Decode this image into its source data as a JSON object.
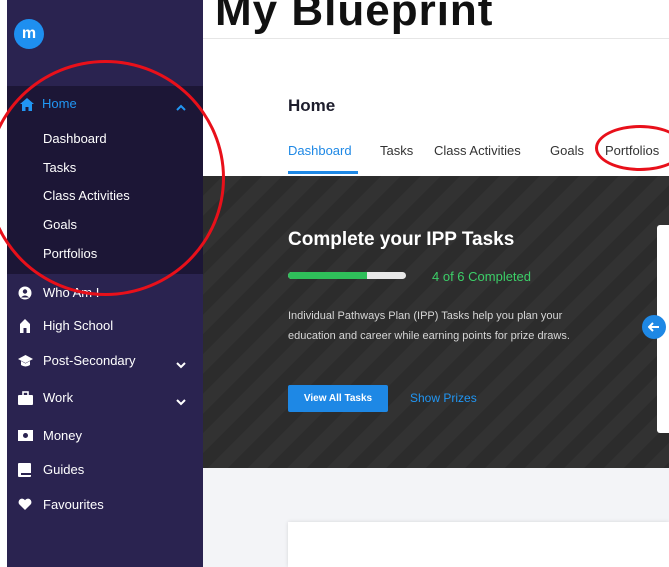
{
  "header": {
    "big_title": "My Blueprint"
  },
  "sidebar": {
    "logo_text": "m",
    "home": {
      "label": "Home",
      "subitems": [
        "Dashboard",
        "Tasks",
        "Class Activities",
        "Goals",
        "Portfolios"
      ]
    },
    "items": [
      {
        "label": "Who Am I",
        "icon": "user-circle-icon"
      },
      {
        "label": "High School",
        "icon": "school-icon"
      },
      {
        "label": "Post-Secondary",
        "icon": "graduation-cap-icon",
        "expandable": true
      },
      {
        "label": "Work",
        "icon": "briefcase-icon",
        "expandable": true
      },
      {
        "label": "Money",
        "icon": "money-icon"
      },
      {
        "label": "Guides",
        "icon": "book-icon"
      },
      {
        "label": "Favourites",
        "icon": "heart-icon"
      }
    ]
  },
  "main": {
    "title": "Home",
    "tabs": [
      "Dashboard",
      "Tasks",
      "Class Activities",
      "Goals",
      "Portfolios"
    ],
    "active_tab": "Dashboard"
  },
  "hero": {
    "title": "Complete your IPP Tasks",
    "progress_text": "4 of 6 Completed",
    "progress_fraction": 0.67,
    "description": "Individual Pathways Plan (IPP) Tasks help you plan your education and career while earning points for prize draws.",
    "primary_button": "View All Tasks",
    "link_button": "Show Prizes"
  },
  "colors": {
    "accent": "#1e88e5",
    "sidebar": "#2a2350",
    "success": "#2fbf5a",
    "annotation": "#e8101a"
  }
}
